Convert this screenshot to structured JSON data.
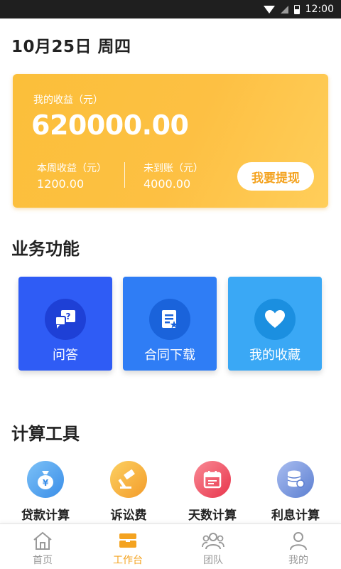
{
  "status_bar": {
    "time": "12:00"
  },
  "date_title": "10月25日 周四",
  "earnings": {
    "total_label": "我的收益（元）",
    "total_value": "620000.00",
    "week_label": "本周收益（元）",
    "week_value": "1200.00",
    "pending_label": "未到账（元）",
    "pending_value": "4000.00",
    "withdraw_button": "我要提现"
  },
  "business_section": {
    "title": "业务功能",
    "items": [
      {
        "label": "问答",
        "icon": "qa-icon",
        "color": "#2f5cf5"
      },
      {
        "label": "合同下载",
        "icon": "contract-icon",
        "color": "#2f7df5"
      },
      {
        "label": "我的收藏",
        "icon": "heart-icon",
        "color": "#3aa8f5"
      }
    ]
  },
  "tools_section": {
    "title": "计算工具",
    "items": [
      {
        "label": "贷款计算",
        "icon": "money-bag-icon",
        "color": "#4aa3f0"
      },
      {
        "label": "诉讼费",
        "icon": "gavel-icon",
        "color": "#f7b13a"
      },
      {
        "label": "天数计算",
        "icon": "calendar-icon",
        "color": "#f0556a"
      },
      {
        "label": "利息计算",
        "icon": "coins-icon",
        "color": "#6f8fd8"
      }
    ]
  },
  "tab_bar": {
    "active_color": "#f4a320",
    "inactive_color": "#999999",
    "tabs": [
      {
        "label": "首页",
        "icon": "home-icon",
        "active": false
      },
      {
        "label": "工作台",
        "icon": "workbench-icon",
        "active": true
      },
      {
        "label": "团队",
        "icon": "team-icon",
        "active": false
      },
      {
        "label": "我的",
        "icon": "profile-icon",
        "active": false
      }
    ]
  }
}
